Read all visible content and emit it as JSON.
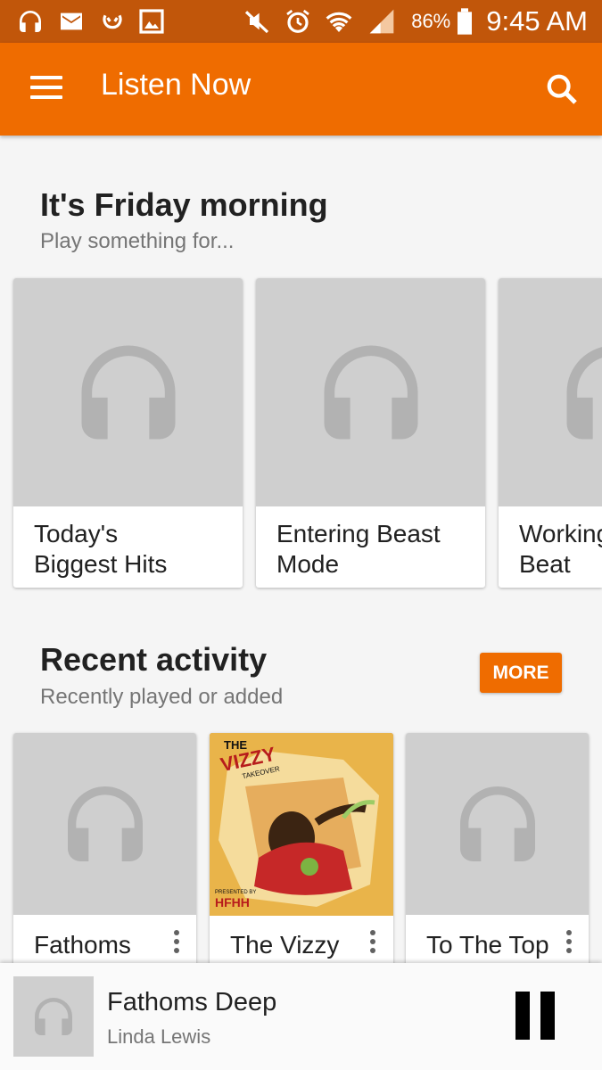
{
  "status_bar": {
    "icons": [
      "headset-icon",
      "mail-icon",
      "voicemail-icon",
      "gallery-icon",
      "mute-icon",
      "alarm-icon",
      "wifi-icon",
      "signal-icon",
      "battery-icon"
    ],
    "battery": "86%",
    "time": "9:45 AM"
  },
  "app_bar": {
    "title": "Listen Now",
    "color": "#ef6c00"
  },
  "section1": {
    "title": "It's Friday morning",
    "subtitle": "Play something for...",
    "cards": [
      {
        "label": "Today's\nBiggest Hits"
      },
      {
        "label": "Entering Beast\nMode"
      },
      {
        "label": "Working\nBeat"
      }
    ]
  },
  "section2": {
    "title": "Recent activity",
    "subtitle": "Recently played or added",
    "more_label": "MORE",
    "cards": [
      {
        "label": "Fathoms"
      },
      {
        "label": "The Vizzy",
        "cover_text_1": "THE",
        "cover_text_2": "VIZZY",
        "cover_text_3": "TAKEOVER",
        "cover_text_4": "PRESENTED BY",
        "cover_text_5": "HFHH"
      },
      {
        "label": "To The Top"
      }
    ]
  },
  "player": {
    "song": "Fathoms Deep",
    "artist": "Linda Lewis"
  }
}
